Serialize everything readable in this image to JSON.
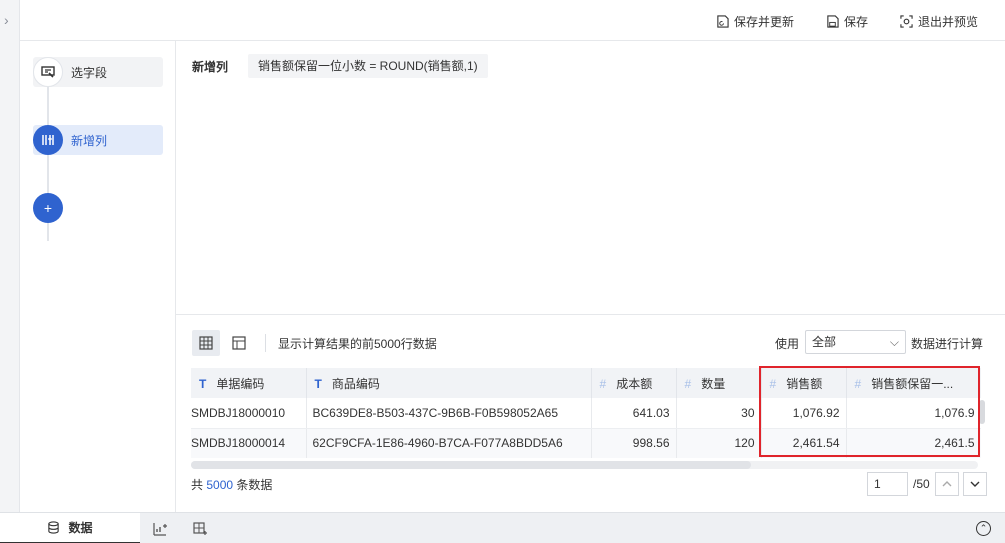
{
  "toolbar": {
    "save_update": "保存并更新",
    "save": "保存",
    "exit_preview": "退出并预览"
  },
  "steps": [
    {
      "label": "选字段",
      "icon": "field-select-icon"
    },
    {
      "label": "新增列",
      "icon": "new-column-icon"
    }
  ],
  "add_step_label": "+",
  "editor": {
    "heading": "新增列",
    "formula": "销售额保留一位小数 = ROUND(销售额,1)"
  },
  "grid_bar": {
    "info": "显示计算结果的前5000行数据",
    "use_label": "使用",
    "select_value": "全部",
    "calc_label": "数据进行计算"
  },
  "table": {
    "columns": [
      {
        "type_icon": "T",
        "label": "单据编码"
      },
      {
        "type_icon": "T",
        "label": "商品编码"
      },
      {
        "type_icon": "#",
        "label": "成本额"
      },
      {
        "type_icon": "#",
        "label": "数量"
      },
      {
        "type_icon": "#",
        "label": "销售额"
      },
      {
        "type_icon": "#",
        "label": "销售额保留一..."
      }
    ],
    "rows": [
      [
        "SMDBJ18000010",
        "BC639DE8-B503-437C-9B6B-F0B598052A65",
        "641.03",
        "30",
        "1,076.92",
        "1,076.9"
      ],
      [
        "SMDBJ18000014",
        "62CF9CFA-1E86-4960-B7CA-F077A8BDD5A6",
        "998.56",
        "120",
        "2,461.54",
        "2,461.5"
      ]
    ]
  },
  "footer": {
    "prefix": "共",
    "count": "5000",
    "suffix": "条数据"
  },
  "pager": {
    "current": "1",
    "total": "/50"
  },
  "bottom_tabs": {
    "data_label": "数据"
  },
  "colors": {
    "accent": "#2f63cf",
    "highlight": "#e0242b"
  }
}
